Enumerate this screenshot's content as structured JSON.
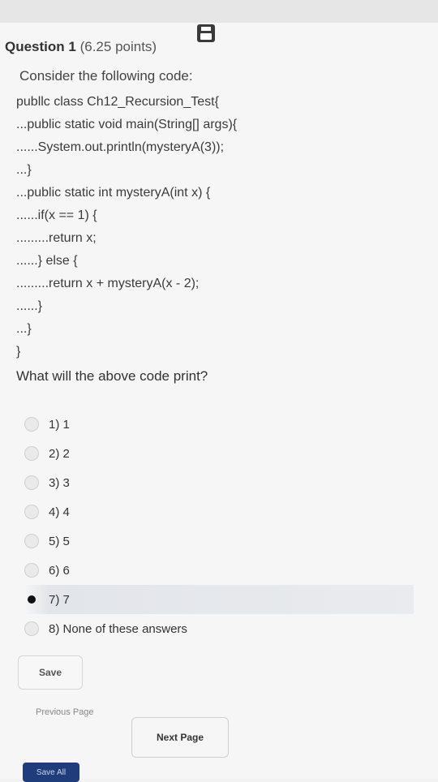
{
  "question": {
    "title_number": "Question 1",
    "title_points": "(6.25 points)",
    "prompt": "Consider the following code:",
    "code_lines": [
      "publlc class Ch12_Recursion_Test{",
      "...public static void main(String[] args){",
      "......System.out.println(mysteryA(3));",
      "...}",
      "...public static int mysteryA(int x) {",
      "......if(x == 1) {",
      ".........return x;",
      "......} else {",
      ".........return x + mysteryA(x - 2);",
      "......}",
      "...}",
      "}"
    ],
    "ask": "What will the above code print?"
  },
  "options": [
    {
      "label": "1) 1",
      "selected": false
    },
    {
      "label": "2) 2",
      "selected": false
    },
    {
      "label": "3) 3",
      "selected": false
    },
    {
      "label": "4) 4",
      "selected": false
    },
    {
      "label": "5) 5",
      "selected": false
    },
    {
      "label": "6) 6",
      "selected": false
    },
    {
      "label": "7) 7",
      "selected": true
    },
    {
      "label": "8) None of these answers",
      "selected": false
    }
  ],
  "actions": {
    "save_label": "Save",
    "previous_label": "Previous Page",
    "next_label": "Next Page",
    "bottom_label": "Save All"
  }
}
